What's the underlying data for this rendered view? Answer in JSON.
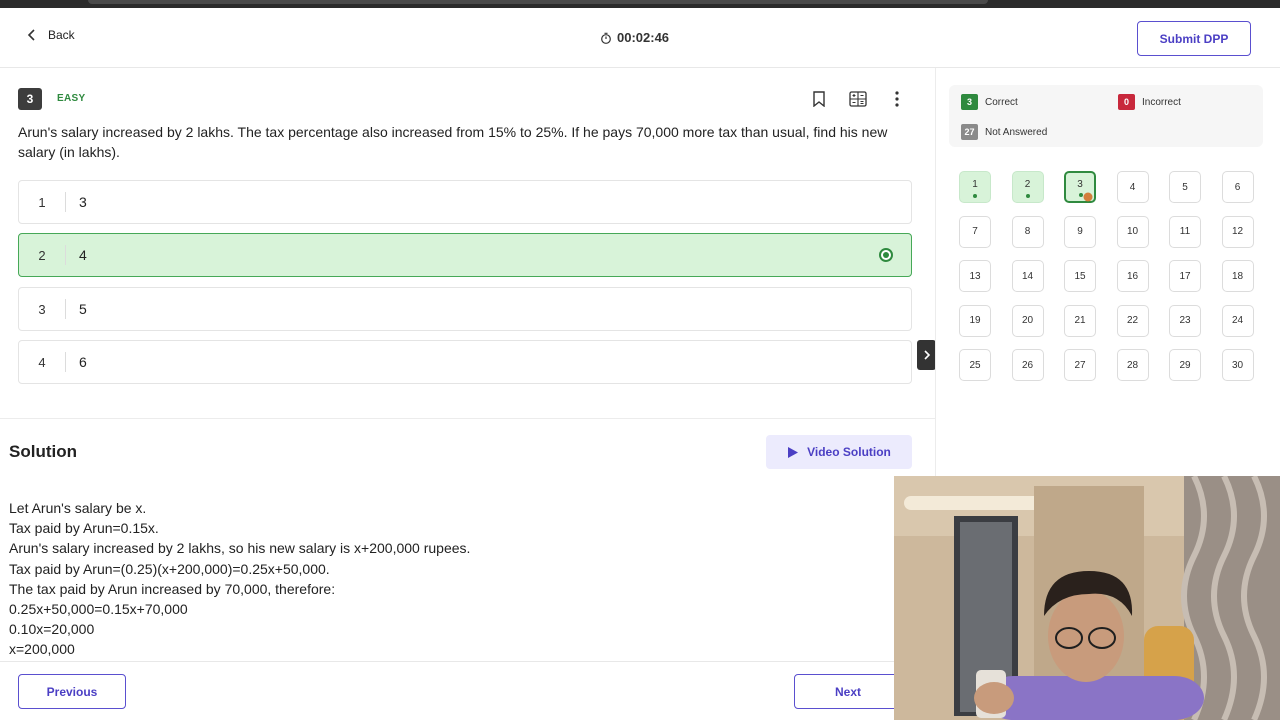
{
  "header": {
    "back_label": "Back",
    "timer": "00:02:46",
    "submit_label": "Submit DPP"
  },
  "question": {
    "number": "3",
    "difficulty": "EASY",
    "text": "Arun's salary increased by 2 lakhs. The tax percentage also increased from 15% to 25%. If he pays 70,000 more tax than usual, find his new salary (in lakhs).",
    "icons": [
      "bookmark-icon",
      "calculator-icon",
      "more-vertical-icon"
    ],
    "options": [
      {
        "num": "1",
        "text": "3"
      },
      {
        "num": "2",
        "text": "4"
      },
      {
        "num": "3",
        "text": "5"
      },
      {
        "num": "4",
        "text": "6"
      }
    ],
    "selected_option": "2"
  },
  "solution": {
    "title": "Solution",
    "video_label": "Video Solution",
    "lines": [
      "Let Arun's salary be x.",
      "Tax paid by Arun=0.15x.",
      "Arun's salary increased by 2 lakhs, so his new salary is x+200,000 rupees.",
      "Tax paid by Arun=(0.25)(x+200,000)=0.25x+50,000.",
      "The tax paid by Arun increased by 70,000, therefore:",
      "0.25x+50,000=0.15x+70,000",
      "0.10x=20,000",
      "x=200,000"
    ]
  },
  "footer": {
    "previous_label": "Previous",
    "next_label": "Next"
  },
  "legend": {
    "correct_count": "3",
    "correct_label": "Correct",
    "incorrect_count": "0",
    "incorrect_label": "Incorrect",
    "not_answered_count": "27",
    "not_answered_label": "Not Answered"
  },
  "palette": {
    "numbers": [
      "1",
      "2",
      "3",
      "4",
      "5",
      "6",
      "7",
      "8",
      "9",
      "10",
      "11",
      "12",
      "13",
      "14",
      "15",
      "16",
      "17",
      "18",
      "19",
      "20",
      "21",
      "22",
      "23",
      "24",
      "25",
      "26",
      "27",
      "28",
      "29",
      "30"
    ],
    "answered": [
      "1",
      "2"
    ],
    "current": "3"
  },
  "colors": {
    "accent": "#4b3fc4",
    "correct": "#2f8a3f",
    "incorrect": "#c8283c",
    "not_answered": "#8a8a8a",
    "selected_bg": "#d8f3d9"
  }
}
